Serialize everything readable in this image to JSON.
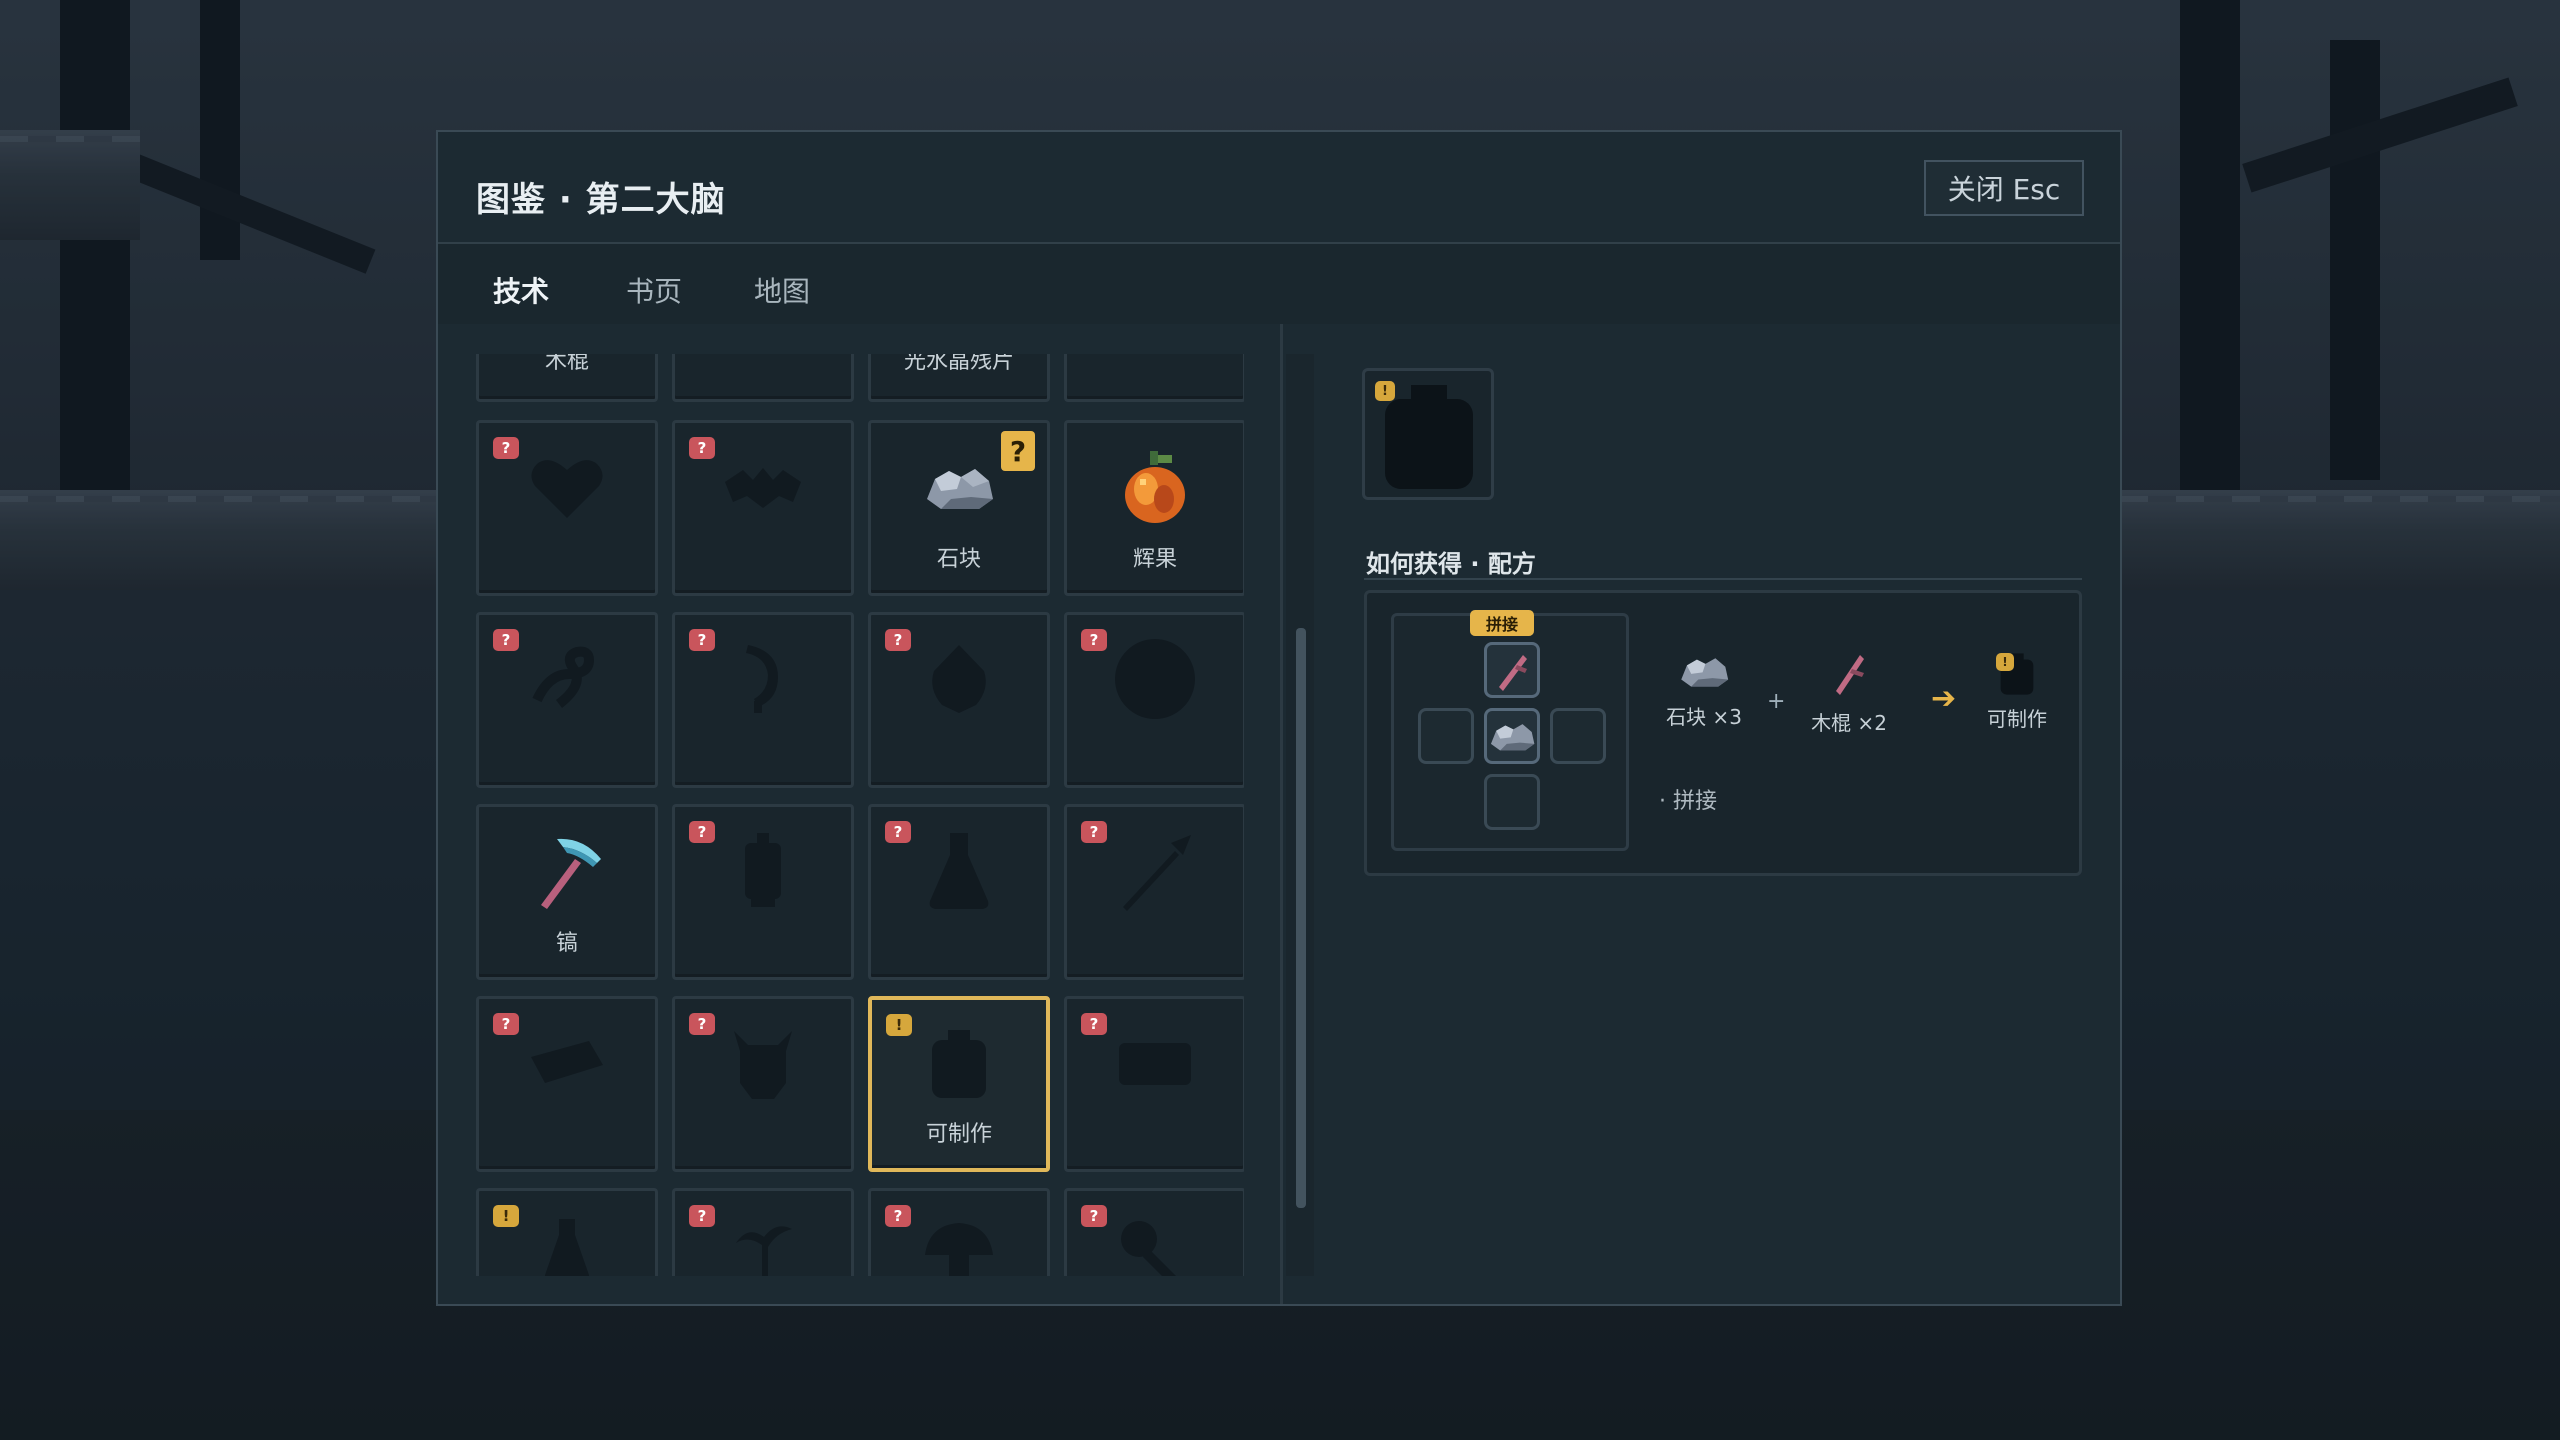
{
  "window": {
    "title": "图鉴 · 第二大脑",
    "close_label": "关闭 Esc"
  },
  "tabs": [
    {
      "label": "技术",
      "active": true
    },
    {
      "label": "书页",
      "active": false
    },
    {
      "label": "地图",
      "active": false
    }
  ],
  "grid": {
    "top_row_labels": [
      "木棍",
      "",
      "光水晶残片",
      ""
    ],
    "cells": [
      {
        "label": "",
        "badge": "?",
        "icon": "heart-silhouette"
      },
      {
        "label": "",
        "badge": "?",
        "icon": "bat-silhouette"
      },
      {
        "label": "石块",
        "badge": "?",
        "icon": "stone"
      },
      {
        "label": "辉果",
        "badge": "",
        "icon": "glow-fruit"
      },
      {
        "label": "",
        "badge": "?",
        "icon": "rope-silhouette"
      },
      {
        "label": "",
        "badge": "?",
        "icon": "hook-silhouette"
      },
      {
        "label": "",
        "badge": "?",
        "icon": "seed-silhouette"
      },
      {
        "label": "",
        "badge": "?",
        "icon": "orb-silhouette"
      },
      {
        "label": "镐",
        "badge": "",
        "icon": "pickaxe"
      },
      {
        "label": "",
        "badge": "?",
        "icon": "lantern-silhouette"
      },
      {
        "label": "",
        "badge": "?",
        "icon": "flask-silhouette"
      },
      {
        "label": "",
        "badge": "?",
        "icon": "spear-silhouette"
      },
      {
        "label": "",
        "badge": "?",
        "icon": "plank-silhouette"
      },
      {
        "label": "",
        "badge": "?",
        "icon": "beetle-silhouette"
      },
      {
        "label": "可制作",
        "badge": "!",
        "icon": "backpack-silhouette"
      },
      {
        "label": "",
        "badge": "?",
        "icon": "box-silhouette"
      },
      {
        "label": "",
        "badge": "!",
        "icon": "potion-silhouette"
      },
      {
        "label": "",
        "badge": "?",
        "icon": "sprout-silhouette"
      },
      {
        "label": "",
        "badge": "?",
        "icon": "mushroom-silhouette"
      },
      {
        "label": "",
        "badge": "?",
        "icon": "key-silhouette"
      }
    ]
  },
  "detail": {
    "thumb_badge": "!",
    "section_title": "如何获得 · 配方",
    "craft_tag": "拼接",
    "ingredients": [
      {
        "label": "石块 ×3",
        "icon": "stone-icon"
      },
      {
        "label": "木棍 ×2",
        "icon": "stick-icon"
      }
    ],
    "plus": "+",
    "result": {
      "label": "可制作",
      "badge": "!"
    },
    "method": "· 拼接"
  },
  "colors": {
    "accent": "#e6b54a",
    "unknown_badge": "#c9555c",
    "panel_bg": "#1c2a32"
  }
}
